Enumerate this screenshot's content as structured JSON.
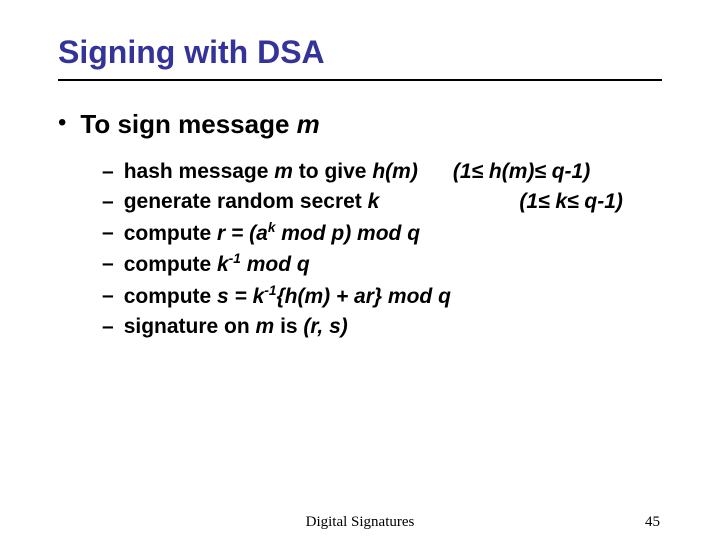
{
  "title": "Signing with DSA",
  "l1": {
    "bullet": "•",
    "html": "To sign message <span class='var'>m</span>"
  },
  "dash": "–",
  "l2": [
    "hash message <span class='var'>m</span> to give <span class='var'>h(m)</span>&nbsp;&nbsp;&nbsp;&nbsp;&nbsp;&nbsp;<span class='var'>(1&le; h(m)&le; q-1)</span>",
    "generate random secret <span class='var'>k</span>&nbsp;&nbsp;&nbsp;&nbsp;&nbsp;&nbsp;&nbsp;&nbsp;&nbsp;&nbsp;&nbsp;&nbsp;&nbsp;&nbsp;&nbsp;&nbsp;&nbsp;&nbsp;&nbsp;&nbsp;&nbsp;&nbsp;&nbsp;&nbsp;<span class='var'>(1&le; k&le; q-1)</span>",
    "compute <span class='var'>r = (a<sup>k</sup> mod p) mod q</span>",
    "compute <span class='var'>k<sup>-1</sup> mod q</span>",
    "compute <span class='var'>s = k<sup>-1</sup>{h(m) + ar} mod q</span>",
    "signature on <span class='var'>m</span> is <span class='var'>(r, s)</span>"
  ],
  "footer": {
    "center": "Digital Signatures",
    "page": "45"
  }
}
